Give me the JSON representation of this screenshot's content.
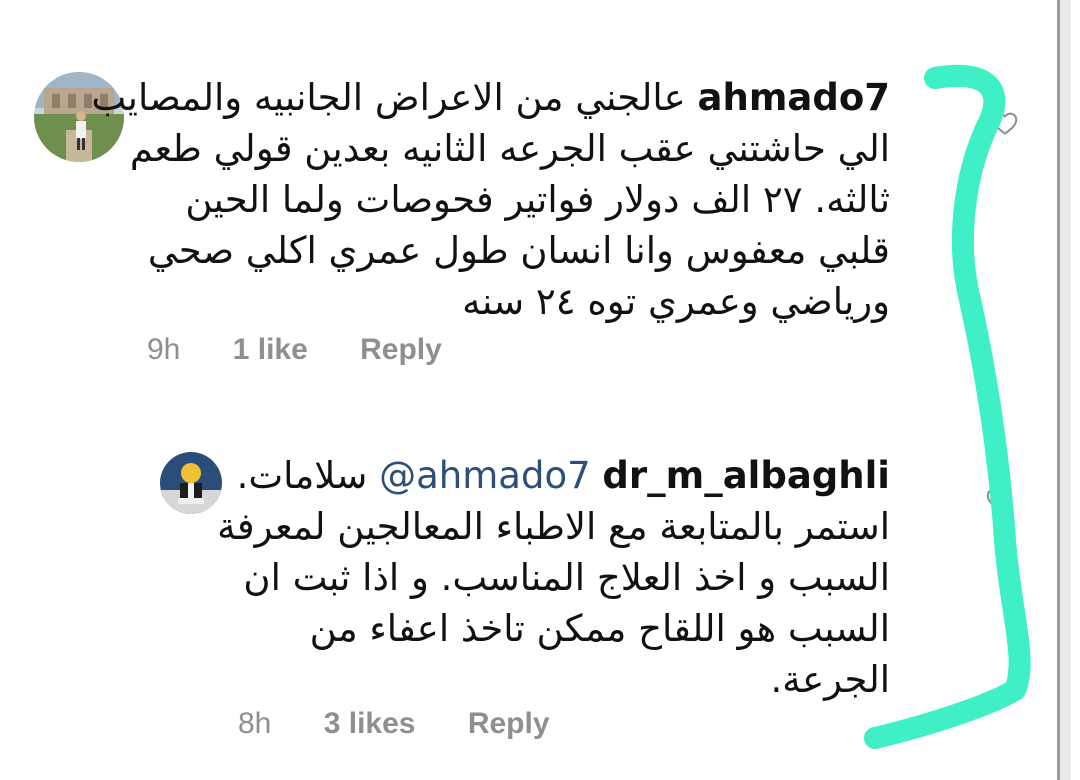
{
  "comments": [
    {
      "username": "ahmado7",
      "lines": [
        "عالجني من الاعراض الجانبيه والمصايب",
        "الي حاشتني عقب الجرعه الثانيه بعدين قولي طعم",
        "ثالثه. ٢٧ الف دولار فواتير فحوصات ولما الحين",
        "قلبي معفوس وانا انسان طول عمري اكلي صحي",
        "ورياضي وعمري توه ٢٤ سنه"
      ],
      "time": "9h",
      "likes": "1 like",
      "reply": "Reply",
      "avatar_icon": "profile-photo"
    },
    {
      "username": "dr_m_albaghli",
      "mention": "@ahmado7",
      "lines": [
        "سلامات.",
        "استمر بالمتابعة مع الاطباء المعالجين لمعرفة",
        "السبب و اخذ العلاج المناسب. و اذا ثبت ان",
        "السبب هو اللقاح ممكن تاخذ اعفاء من",
        "الجرعة."
      ],
      "time": "8h",
      "likes": "3 likes",
      "reply": "Reply",
      "avatar_icon": "profile-photo"
    }
  ],
  "icons": {
    "like": "heart-outline-icon"
  },
  "colors": {
    "annotation": "#3ff0c6",
    "meta_text": "#8e8e93",
    "mention": "#2b4f7a"
  }
}
